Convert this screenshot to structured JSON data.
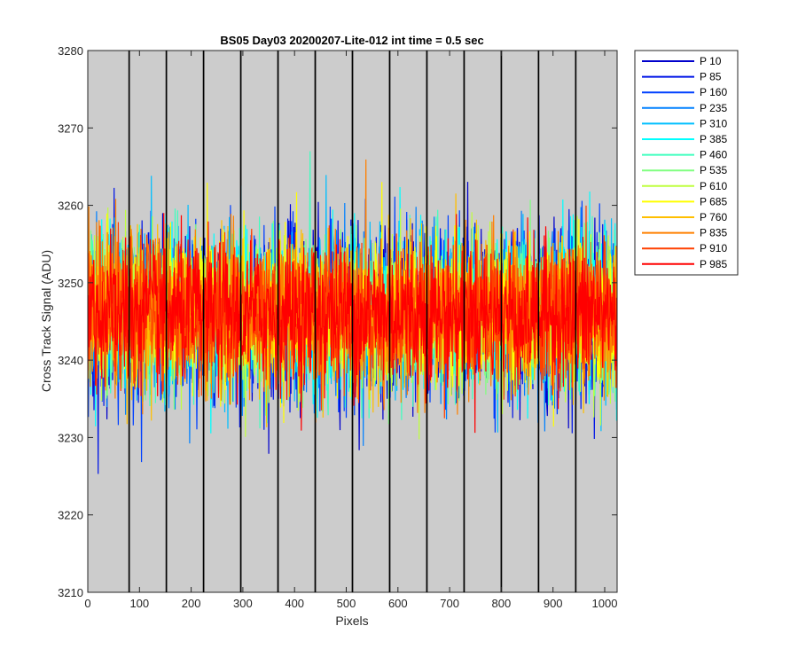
{
  "chart_data": {
    "type": "line",
    "title": "BS05 Day03 20200207-Lite-012 int time = 0.5 sec",
    "xlabel": "Pixels",
    "ylabel": "Cross Track Signal (ADU)",
    "xlim": [
      0,
      1024
    ],
    "ylim": [
      3210,
      3280
    ],
    "xticks": [
      0,
      100,
      200,
      300,
      400,
      500,
      600,
      700,
      800,
      900,
      1000
    ],
    "yticks": [
      3210,
      3220,
      3230,
      3240,
      3250,
      3260,
      3270,
      3280
    ],
    "tap_boundaries": [
      80,
      152,
      224,
      296,
      368,
      440,
      512,
      584,
      656,
      728,
      800,
      872,
      944
    ],
    "background_color": "#cccccc",
    "noise_center": 3246,
    "noise_range": [
      3218,
      3276
    ],
    "legend_position": "outside-right",
    "series": [
      {
        "name": "P 10",
        "color": "#0000cc"
      },
      {
        "name": "P 85",
        "color": "#0015e6"
      },
      {
        "name": "P 160",
        "color": "#0040ff"
      },
      {
        "name": "P 235",
        "color": "#0080ff"
      },
      {
        "name": "P 310",
        "color": "#00bfff"
      },
      {
        "name": "P 385",
        "color": "#00ffff"
      },
      {
        "name": "P 460",
        "color": "#40ffbf"
      },
      {
        "name": "P 535",
        "color": "#80ff80"
      },
      {
        "name": "P 610",
        "color": "#bfff40"
      },
      {
        "name": "P 685",
        "color": "#ffff00"
      },
      {
        "name": "P 760",
        "color": "#ffbf00"
      },
      {
        "name": "P 835",
        "color": "#ff8000"
      },
      {
        "name": "P 910",
        "color": "#ff4000"
      },
      {
        "name": "P 985",
        "color": "#ff0000"
      }
    ]
  }
}
